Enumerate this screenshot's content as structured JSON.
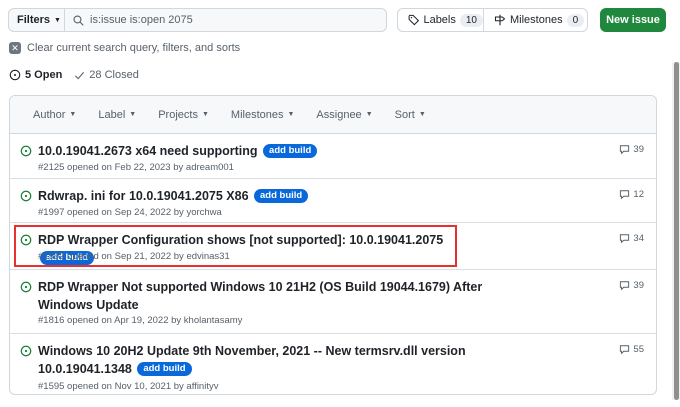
{
  "toolbar": {
    "filters_label": "Filters",
    "search_value": "is:issue is:open 2075",
    "labels_label": "Labels",
    "labels_count": "10",
    "milestones_label": "Milestones",
    "milestones_count": "0",
    "new_issue_label": "New issue"
  },
  "clear_filters_text": "Clear current search query, filters, and sorts",
  "states": {
    "open": "5 Open",
    "closed": "28 Closed"
  },
  "header_filters": [
    {
      "label": "Author"
    },
    {
      "label": "Label"
    },
    {
      "label": "Projects"
    },
    {
      "label": "Milestones"
    },
    {
      "label": "Assignee"
    },
    {
      "label": "Sort"
    }
  ],
  "issues": [
    {
      "title": "10.0.19041.2673 x64 need supporting",
      "label": "add build",
      "meta": "#2125 opened on Feb 22, 2023 by adream001",
      "comments": "39"
    },
    {
      "title": "Rdwrap. ini for 10.0.19041.2075 X86",
      "label": "add build",
      "meta": "#1997 opened on Sep 24, 2022 by yorchwa",
      "comments": "12"
    },
    {
      "title": "RDP Wrapper Configuration shows [not supported]: 10.0.19041.2075",
      "label": "add build",
      "meta": "#1992 opened on Sep 21, 2022 by edvinas31",
      "comments": "34"
    },
    {
      "title": "RDP Wrapper Not supported Windows 10 21H2 (OS Build 19044.1679) After Windows Update",
      "label": "",
      "meta": "#1816 opened on Apr 19, 2022 by kholantasamy",
      "comments": "39"
    },
    {
      "title": "Windows 10 20H2 Update 9th November, 2021 -- New termsrv.dll version 10.0.19041.1348",
      "label": "add build",
      "meta": "#1595 opened on Nov 10, 2021 by affinityv",
      "comments": "55"
    }
  ],
  "colors": {
    "accent_green": "#1f883d",
    "label_blue": "#0969da",
    "highlight_red": "#e5312f"
  }
}
